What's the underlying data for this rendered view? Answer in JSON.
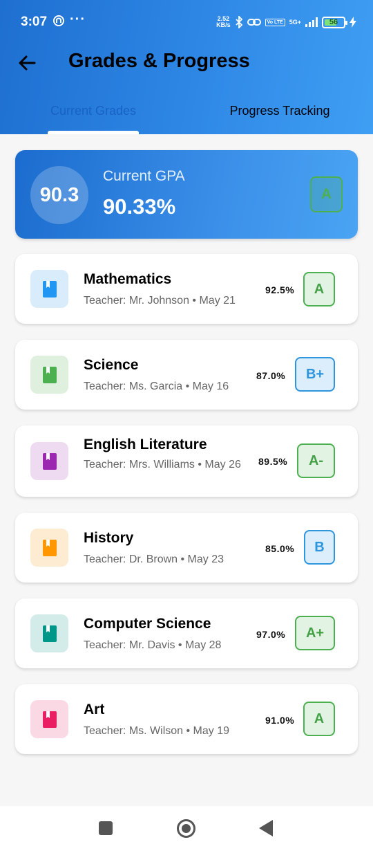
{
  "status_bar": {
    "time": "3:07",
    "dots": "···",
    "net_speed_value": "2.52",
    "net_speed_unit": "KB/s",
    "volte": "Vo LTE",
    "network": "5G+",
    "battery": "56"
  },
  "app_bar": {
    "title": "Grades & Progress",
    "back_icon": "arrow-left-icon"
  },
  "tabs": [
    {
      "label": "Current Grades",
      "selected": true
    },
    {
      "label": "Progress Tracking",
      "selected": false
    }
  ],
  "gpa": {
    "circle_value": "90.3",
    "label": "Current GPA",
    "percent": "90.33%",
    "grade": "A"
  },
  "subjects": [
    {
      "name": "Mathematics",
      "meta": "Teacher: Mr. Johnson • May 21",
      "score": "92.5%",
      "grade": "A",
      "icon": "book-icon",
      "icon_color": "#2196f3",
      "icon_bg": "#d9ecfb",
      "grade_style": "green"
    },
    {
      "name": "Science",
      "meta": "Teacher: Ms. Garcia • May 16",
      "score": "87.0%",
      "grade": "B+",
      "icon": "book-icon",
      "icon_color": "#4caf50",
      "icon_bg": "#dff0df",
      "grade_style": "blue"
    },
    {
      "name": "English Literature",
      "meta": "Teacher: Mrs. Williams • May 26",
      "score": "89.5%",
      "grade": "A-",
      "icon": "book-icon",
      "icon_color": "#9c27b0",
      "icon_bg": "#eedaf1",
      "grade_style": "green"
    },
    {
      "name": "History",
      "meta": "Teacher: Dr. Brown • May 23",
      "score": "85.0%",
      "grade": "B",
      "icon": "book-icon",
      "icon_color": "#ff9800",
      "icon_bg": "#fdebd2",
      "grade_style": "blue"
    },
    {
      "name": "Computer Science",
      "meta": "Teacher: Mr. Davis • May 28",
      "score": "97.0%",
      "grade": "A+",
      "icon": "book-icon",
      "icon_color": "#009688",
      "icon_bg": "#d3ecea",
      "grade_style": "green"
    },
    {
      "name": "Art",
      "meta": "Teacher: Ms. Wilson • May 19",
      "score": "91.0%",
      "grade": "A",
      "icon": "book-icon",
      "icon_color": "#e91e63",
      "icon_bg": "#fbd9e4",
      "grade_style": "green"
    }
  ],
  "colors": {
    "accent": "#2f88e6",
    "grade_green": "#4caf50",
    "grade_blue": "#2f95dc"
  },
  "nav_bar": {
    "recents_icon": "square-icon",
    "home_icon": "circle-home-icon",
    "back_icon": "triangle-back-icon"
  }
}
